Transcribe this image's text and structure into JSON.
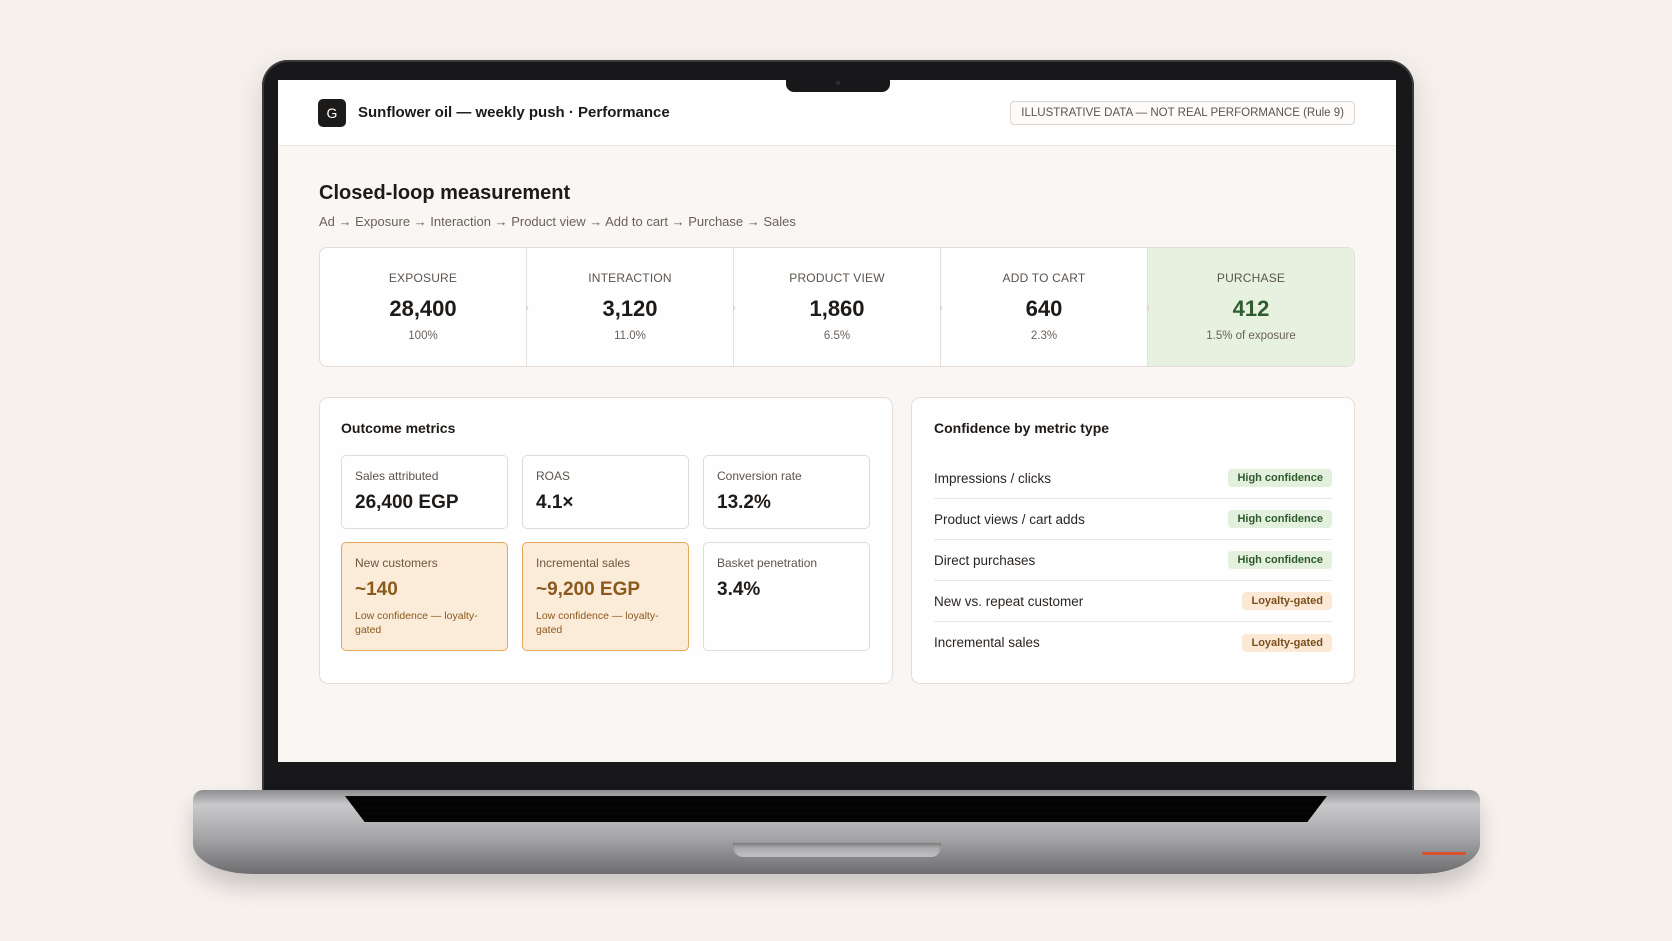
{
  "header": {
    "logo_letter": "G",
    "title": "Sunflower oil — weekly push · Performance",
    "disclaimer": "ILLUSTRATIVE DATA — NOT REAL PERFORMANCE (Rule 9)"
  },
  "page": {
    "title": "Closed-loop measurement",
    "flow": "Ad → Exposure → Interaction → Product view → Add to cart → Purchase → Sales"
  },
  "funnel": [
    {
      "label": "EXPOSURE",
      "value": "28,400",
      "sub": "100%"
    },
    {
      "label": "INTERACTION",
      "value": "3,120",
      "sub": "11.0%"
    },
    {
      "label": "PRODUCT VIEW",
      "value": "1,860",
      "sub": "6.5%"
    },
    {
      "label": "ADD TO CART",
      "value": "640",
      "sub": "2.3%"
    },
    {
      "label": "PURCHASE",
      "value": "412",
      "sub": "1.5% of exposure"
    }
  ],
  "outcome": {
    "title": "Outcome metrics",
    "metrics": [
      {
        "label": "Sales attributed",
        "value": "26,400 EGP"
      },
      {
        "label": "ROAS",
        "value": "4.1×"
      },
      {
        "label": "Conversion rate",
        "value": "13.2%"
      },
      {
        "label": "New customers",
        "value": "~140",
        "note": "Low confidence — loyalty-gated"
      },
      {
        "label": "Incremental sales",
        "value": "~9,200 EGP",
        "note": "Low confidence — loyalty-gated"
      },
      {
        "label": "Basket penetration",
        "value": "3.4%"
      }
    ]
  },
  "confidence": {
    "title": "Confidence by metric type",
    "rows": [
      {
        "label": "Impressions / clicks",
        "badge": "High confidence"
      },
      {
        "label": "Product views / cart adds",
        "badge": "High confidence"
      },
      {
        "label": "Direct purchases",
        "badge": "High confidence"
      },
      {
        "label": "New vs. repeat customer",
        "badge": "Loyalty-gated"
      },
      {
        "label": "Incremental sales",
        "badge": "Loyalty-gated"
      }
    ]
  },
  "colors": {
    "highlight_green": "#e6f1df",
    "warning_orange": "#fbebd9",
    "warning_border": "#e7a75b",
    "high_badge": "#e3f0dd",
    "loyalty_badge": "#fbe9d6"
  },
  "icons": {
    "funnel_separator": "chevron-right-icon"
  }
}
